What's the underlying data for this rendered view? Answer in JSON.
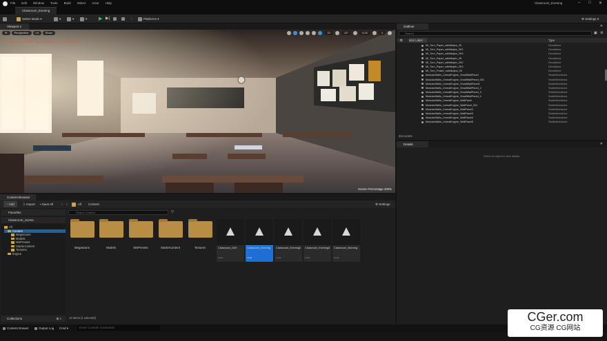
{
  "app": {
    "title": "Classroom_Evening",
    "tab": "Classroom_Evening",
    "menu": [
      "File",
      "Edit",
      "Window",
      "Tools",
      "Build",
      "Select",
      "Actor",
      "Help"
    ]
  },
  "toolbar": {
    "mode": "Select Mode",
    "platforms": "Platforms",
    "settings": "Settings"
  },
  "viewport": {
    "tab": "Viewport 1",
    "perspective": "Perspective",
    "lit": "Lit",
    "show": "Show",
    "warning": "LIGHTING NEEDS TO BE REBUILT (1 unbuilt object)",
    "grid": "10",
    "angle": "10°",
    "scale": "0.25",
    "cam": "4",
    "screen_pct": "Screen Percentage  200%"
  },
  "content_browser": {
    "tab": "Content Browser",
    "add": "Add",
    "import": "Import",
    "save_all": "Save All",
    "settings": "Settings",
    "path": [
      "All",
      "Content"
    ],
    "favorites": "Favorites",
    "root": "Classroom_Scene",
    "search_placeholder": "Search Content",
    "collections": "Collections",
    "items_status": "10 items (1 selected)",
    "tree": [
      "All",
      "Content",
      "Megascans",
      "Models",
      "MSPresets",
      "StarterContent",
      "Textures",
      "Engine"
    ],
    "folders": [
      "Megascans",
      "Models",
      "MSPresets",
      "StarterContent",
      "Textures"
    ],
    "assets": [
      {
        "name": "Classroom_DAY",
        "type": "Level"
      },
      {
        "name": "Classroom_Evening",
        "type": "Level"
      },
      {
        "name": "Classroom_Evening2",
        "type": "Level"
      },
      {
        "name": "Classroom_Evening3",
        "type": "Level"
      },
      {
        "name": "Classroom_Morning",
        "type": "Level"
      }
    ]
  },
  "bottom": {
    "content_drawer": "Content Drawer",
    "output_log": "Output Log",
    "cmd": "Cmd",
    "console_placeholder": "Enter Console Command"
  },
  "outliner": {
    "tab": "Outliner",
    "search_placeholder": "Search",
    "col_label": "Item Label",
    "col_type": "Type",
    "actors": "324 actors",
    "rows": [
      {
        "n": "MI_Torn_Paper_sdhfdkqba_2K",
        "t": "DecalActor"
      },
      {
        "n": "MI_Torn_Paper_sdhfdkqba_2K2",
        "t": "DecalActor"
      },
      {
        "n": "MI_Torn_Paper_sdhfdkqba_2K3",
        "t": "DecalActor"
      },
      {
        "n": "MI_Torn_Paper_sdhfdkqbh_2K",
        "t": "DecalActor"
      },
      {
        "n": "MI_Torn_Paper_sdhfdkqbh_2K2",
        "t": "DecalActor"
      },
      {
        "n": "MI_Torn_Paper_sdhfdkqbh_2K3",
        "t": "DecalActor"
      },
      {
        "n": "MI_Torn_Poster_sdhfdkqba_2K",
        "t": "DecalActor"
      },
      {
        "n": "ModularWalls_UnrealEngine_SmallWallPanel",
        "t": "StaticMeshActor"
      },
      {
        "n": "ModularWalls_UnrealEngine_SmallWallPanel_001",
        "t": "StaticMeshActor"
      },
      {
        "n": "ModularWalls_UnrealEngine_SmallWallPanel1",
        "t": "StaticMeshActor"
      },
      {
        "n": "ModularWalls_UnrealEngine_SmallWallPanel_2",
        "t": "StaticMeshActor"
      },
      {
        "n": "ModularWalls_UnrealEngine_SmallWallPanel_3",
        "t": "StaticMeshActor"
      },
      {
        "n": "ModularWalls_UnrealEngine_SmallWallPanel_4",
        "t": "StaticMeshActor"
      },
      {
        "n": "ModularWalls_UnrealEngine_WallPanel",
        "t": "StaticMeshActor"
      },
      {
        "n": "ModularWalls_UnrealEngine_WallPanel_001",
        "t": "StaticMeshActor"
      },
      {
        "n": "ModularWalls_UnrealEngine_WallPanel2",
        "t": "StaticMeshActor"
      },
      {
        "n": "ModularWalls_UnrealEngine_WallPanel3",
        "t": "StaticMeshActor"
      },
      {
        "n": "ModularWalls_UnrealEngine_WallPanel4",
        "t": "StaticMeshActor"
      },
      {
        "n": "ModularWalls_UnrealEngine_WallPanel5",
        "t": "StaticMeshActor"
      }
    ]
  },
  "details": {
    "tab": "Details",
    "empty": "Select an object to view details."
  },
  "watermark": {
    "line1": "CGer.com",
    "line2": "CG资源  CG网站"
  }
}
